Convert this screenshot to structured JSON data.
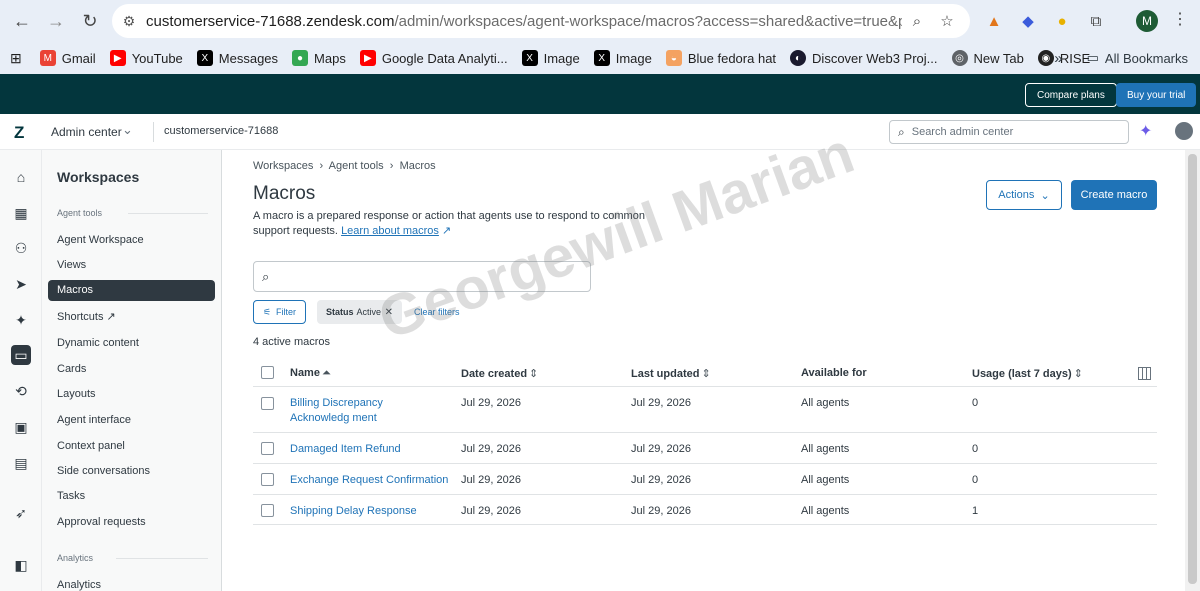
{
  "browser": {
    "url_host": "customerservice-71688.zendesk.com",
    "url_path": "/admin/workspaces/agent-workspace/macros?access=shared&active=true&page=1&per_...",
    "profile_initial": "M",
    "bookmarks": [
      "Gmail",
      "YouTube",
      "Messages",
      "Maps",
      "Google Data Analyti...",
      "Image",
      "Image",
      "Blue fedora hat",
      "Discover Web3 Proj...",
      "New Tab",
      "RISE"
    ],
    "all_bookmarks": "All Bookmarks",
    "overflow": "»"
  },
  "topbar": {
    "compare_plans": "Compare plans",
    "buy_trial": "Buy your trial"
  },
  "header": {
    "admin_center": "Admin center",
    "subdomain": "customerservice-71688",
    "search_placeholder": "Search admin center"
  },
  "sidebar": {
    "title": "Workspaces",
    "section_agent_tools": "Agent tools",
    "items": [
      "Agent Workspace",
      "Views",
      "Macros",
      "Shortcuts",
      "Dynamic content",
      "Cards",
      "Layouts",
      "Agent interface",
      "Context panel",
      "Side conversations",
      "Tasks",
      "Approval requests"
    ],
    "section_analytics": "Analytics",
    "analytics_item": "Analytics"
  },
  "main": {
    "breadcrumb": [
      "Workspaces",
      "Agent tools",
      "Macros"
    ],
    "title": "Macros",
    "description": "A macro is a prepared response or action that agents use to respond to common support requests.",
    "learn_more": "Learn about macros",
    "actions_label": "Actions",
    "create_label": "Create macro",
    "filter_label": "Filter",
    "chip_key": "Status",
    "chip_value": "Active",
    "clear_filters": "Clear filters",
    "count_text": "4 active macros",
    "columns": [
      "Name",
      "Date created",
      "Last updated",
      "Available for",
      "Usage (last 7 days)"
    ],
    "rows": [
      {
        "name": "Billing Discrepancy Acknowledg ment",
        "created": "Jul 29, 2026",
        "updated": "Jul 29, 2026",
        "available": "All agents",
        "usage": "0"
      },
      {
        "name": "Damaged Item Refund",
        "created": "Jul 29, 2026",
        "updated": "Jul 29, 2026",
        "available": "All agents",
        "usage": "0"
      },
      {
        "name": "Exchange Request Confirmation",
        "created": "Jul 29, 2026",
        "updated": "Jul 29, 2026",
        "available": "All agents",
        "usage": "0"
      },
      {
        "name": "Shipping Delay Response",
        "created": "Jul 29, 2026",
        "updated": "Jul 29, 2026",
        "available": "All agents",
        "usage": "1"
      }
    ]
  },
  "watermark": "Georgewill Marian"
}
